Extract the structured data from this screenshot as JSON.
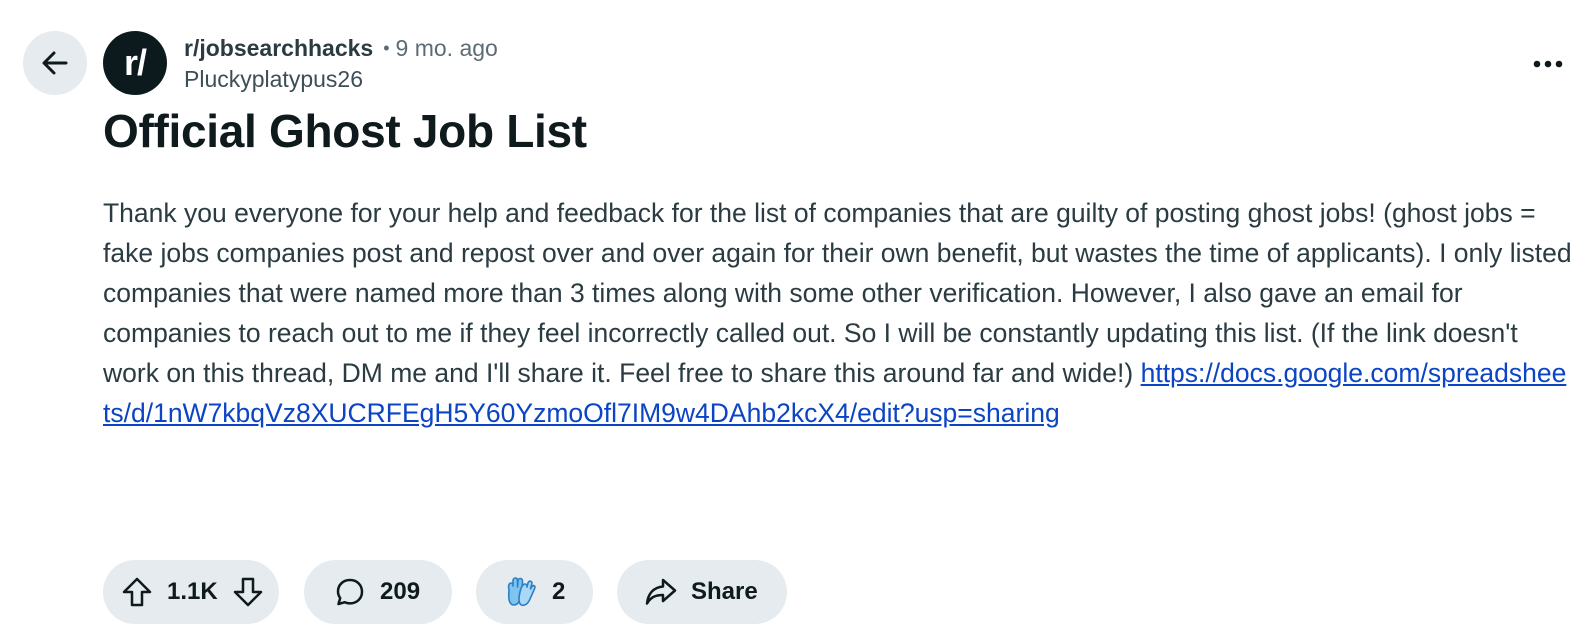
{
  "post": {
    "subreddit": "r/jobsearchhacks",
    "separator": "•",
    "timestamp": "9 mo. ago",
    "author": "Pluckyplatypus26",
    "avatar_text": "r/",
    "title": "Official Ghost Job List",
    "body": "Thank you everyone for your help and feedback for the list of companies that are guilty of posting ghost jobs! (ghost jobs = fake jobs companies post and repost over and over again for their own benefit, but wastes the time of applicants). I only listed companies that were named more than 3 times along with some other verification. However, I also gave an email for companies to reach out to me if they feel incorrectly called out. So I will be constantly updating this list. (If the link doesn't work on this thread, DM me and I'll share it. Feel free to share this around far and wide!)",
    "link": "https://docs.google.com/spreadsheets/d/1nW7kbqVz8XUCRFEgH5Y60YzmoOfl7IM9w4DAhb2kcX4/edit?usp=sharing"
  },
  "actions": {
    "votes": "1.1K",
    "comments": "209",
    "awards": "2",
    "share_label": "Share"
  },
  "icons": {
    "back": "arrow-left-icon",
    "more": "more-horizontal-icon",
    "upvote": "arrow-up-icon",
    "downvote": "arrow-down-icon",
    "comment": "speech-bubble-icon",
    "award": "clapping-hands-icon",
    "share": "share-arrow-icon"
  },
  "colors": {
    "pill_background": "#e5ebee",
    "link": "#0b44c4",
    "avatar": "#0c1a1d"
  }
}
